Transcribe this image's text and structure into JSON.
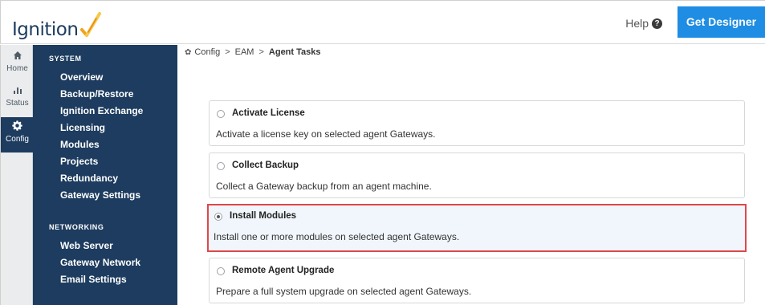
{
  "header": {
    "logo_text": "Ignition",
    "help_label": "Help",
    "help_icon": "question-circle-icon",
    "get_designer_label": "Get Designer",
    "accent_color": "#1e8de3",
    "brand_color": "#1d3c5f"
  },
  "rail": {
    "items": [
      {
        "label": "Home",
        "icon": "home-icon"
      },
      {
        "label": "Status",
        "icon": "bar-chart-icon"
      },
      {
        "label": "Config",
        "icon": "gear-icon",
        "active": true
      }
    ]
  },
  "nav": {
    "system_label": "SYSTEM",
    "system_items": [
      "Overview",
      "Backup/Restore",
      "Ignition Exchange",
      "Licensing",
      "Modules",
      "Projects",
      "Redundancy",
      "Gateway Settings"
    ],
    "networking_label": "NETWORKING",
    "networking_items": [
      "Web Server",
      "Gateway Network",
      "Email Settings"
    ]
  },
  "breadcrumb": {
    "items": [
      "Config",
      "EAM",
      "Agent Tasks"
    ],
    "separator": ">"
  },
  "tasks": [
    {
      "title": "Activate License",
      "description": "Activate a license key on selected agent Gateways.",
      "selected": false
    },
    {
      "title": "Collect Backup",
      "description": "Collect a Gateway backup from an agent machine.",
      "selected": false
    },
    {
      "title": "Install Modules",
      "description": "Install one or more modules on selected agent Gateways.",
      "selected": true
    },
    {
      "title": "Remote Agent Upgrade",
      "description": "Prepare a full system upgrade on selected agent Gateways.",
      "selected": false
    }
  ]
}
